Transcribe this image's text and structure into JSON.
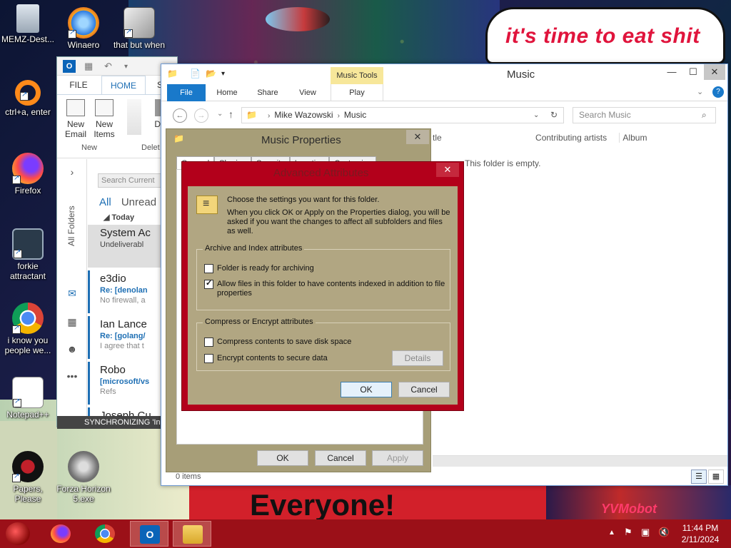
{
  "colors": {
    "explorer_accent": "#1979ca",
    "advanced_dialog_frame": "#b3001b",
    "properties_dialog_frame": "#a79e78",
    "taskbar": "#9b1018",
    "outlook_accent": "#1e6fb4",
    "wallpaper_speech_text": "#e0143c"
  },
  "wallpaper": {
    "speech_bubble": "it's time to eat shit",
    "banner": "Everyone!",
    "right_text": "YVMobot"
  },
  "desktop_icons": [
    {
      "label": "MEMZ-Dest...",
      "icon": "recycle-bin-icon"
    },
    {
      "label": "Winaero",
      "icon": "winaero-icon"
    },
    {
      "label": "that but when",
      "icon": "windows-icon"
    },
    {
      "label": "ctrl+a, enter",
      "icon": "ring-icon"
    },
    {
      "label": "Firefox",
      "icon": "firefox-icon"
    },
    {
      "label": "forkie attractant",
      "icon": "settings-monitor-icon"
    },
    {
      "label": "i know you people we...",
      "icon": "chrome-icon"
    },
    {
      "label": "Notepad++",
      "icon": "notepad-plus-plus-icon"
    },
    {
      "label": "Papers, Please",
      "icon": "papers-please-icon"
    },
    {
      "label": "Forza Horizon 5.exe",
      "icon": "flash-icon"
    }
  ],
  "outlook": {
    "tabs": [
      "FILE",
      "HOME",
      "S"
    ],
    "ribbon": {
      "new_email": "New Email",
      "new_items": "New Items",
      "delete_partial": "De",
      "group_new": "New",
      "group_delete": "Delet"
    },
    "all_folders": "All Folders",
    "search_placeholder": "Search Current",
    "filter_all": "All",
    "filter_unread": "Unread",
    "group_today": "Today",
    "messages": [
      {
        "from": "System Ac",
        "subject": "Undeliverabl",
        "preview": ""
      },
      {
        "from": "e3dio",
        "subject": "Re: [denolan",
        "preview": "No firewall, a"
      },
      {
        "from": "Ian Lance",
        "subject": "Re: [golang/",
        "preview": "I agree that t"
      },
      {
        "from": "Robo",
        "subject": "[microsoft/vs",
        "preview": "Refs"
      },
      {
        "from": "Joseph Cu",
        "subject": "",
        "preview": ""
      }
    ],
    "status": "SYNCHRONIZING 'In"
  },
  "explorer": {
    "window_title": "Music",
    "context_tab": "Music Tools",
    "tabs": [
      "File",
      "Home",
      "Share",
      "View",
      "Play"
    ],
    "breadcrumb": [
      "Mike Wazowski",
      "Music"
    ],
    "search_placeholder": "Search Music",
    "columns": [
      "tle",
      "Contributing artists",
      "Album"
    ],
    "empty_text": "This folder is empty.",
    "status": "0 items"
  },
  "properties_dialog": {
    "title": "Music Properties",
    "tabs": [
      "General",
      "Sharing",
      "Security",
      "Location",
      "Customize"
    ],
    "ok": "OK",
    "cancel": "Cancel",
    "apply": "Apply"
  },
  "advanced_dialog": {
    "title": "Advanced Attributes",
    "intro": "Choose the settings you want for this folder.",
    "note": "When you click OK or Apply on the Properties dialog, you will be asked if you want the changes to affect all subfolders and files as well.",
    "archive_group": "Archive and Index attributes",
    "archive_option": "Folder is ready for archiving",
    "archive_checked": false,
    "index_option": "Allow files in this folder to have contents indexed in addition to file properties",
    "index_checked": true,
    "compress_group": "Compress or Encrypt attributes",
    "compress_option": "Compress contents to save disk space",
    "compress_checked": false,
    "encrypt_option": "Encrypt contents to secure data",
    "encrypt_checked": false,
    "details": "Details",
    "ok": "OK",
    "cancel": "Cancel"
  },
  "taskbar": {
    "time": "11:44 PM",
    "date": "2/11/2024",
    "apps": [
      "firefox-icon",
      "chrome-icon",
      "outlook-icon",
      "file-explorer-icon"
    ]
  }
}
